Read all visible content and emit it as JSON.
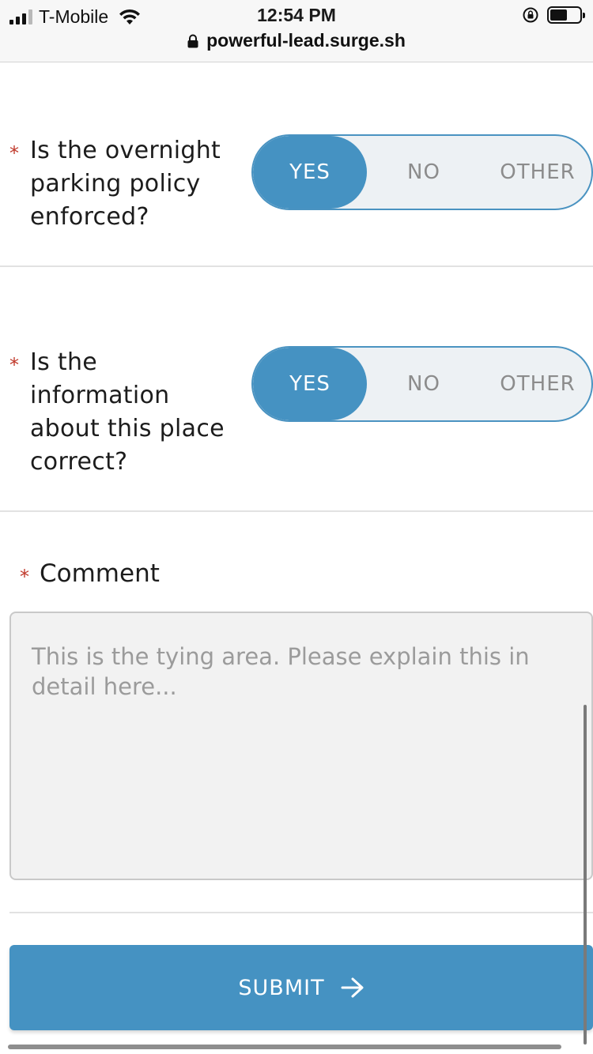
{
  "status_bar": {
    "carrier": "T-Mobile",
    "time": "12:54 PM",
    "url": "powerful-lead.surge.sh"
  },
  "questions": [
    {
      "required_mark": "*",
      "label_lines": [
        "Is the overnight",
        "parking policy",
        "enforced?"
      ],
      "options": [
        "YES",
        "NO",
        "OTHER"
      ],
      "selected": "YES"
    },
    {
      "required_mark": "*",
      "label_lines": [
        "Is the",
        "information",
        "about this place",
        "correct?"
      ],
      "options": [
        "YES",
        "NO",
        "OTHER"
      ],
      "selected": "YES"
    }
  ],
  "comment": {
    "required_mark": "*",
    "label": "Comment",
    "value": "",
    "placeholder": "This is the tying area. Please explain this in detail here..."
  },
  "submit": {
    "label": "SUBMIT"
  },
  "colors": {
    "accent": "#4592c2",
    "required": "#c0392b",
    "toggle_bg": "#edf1f4"
  }
}
